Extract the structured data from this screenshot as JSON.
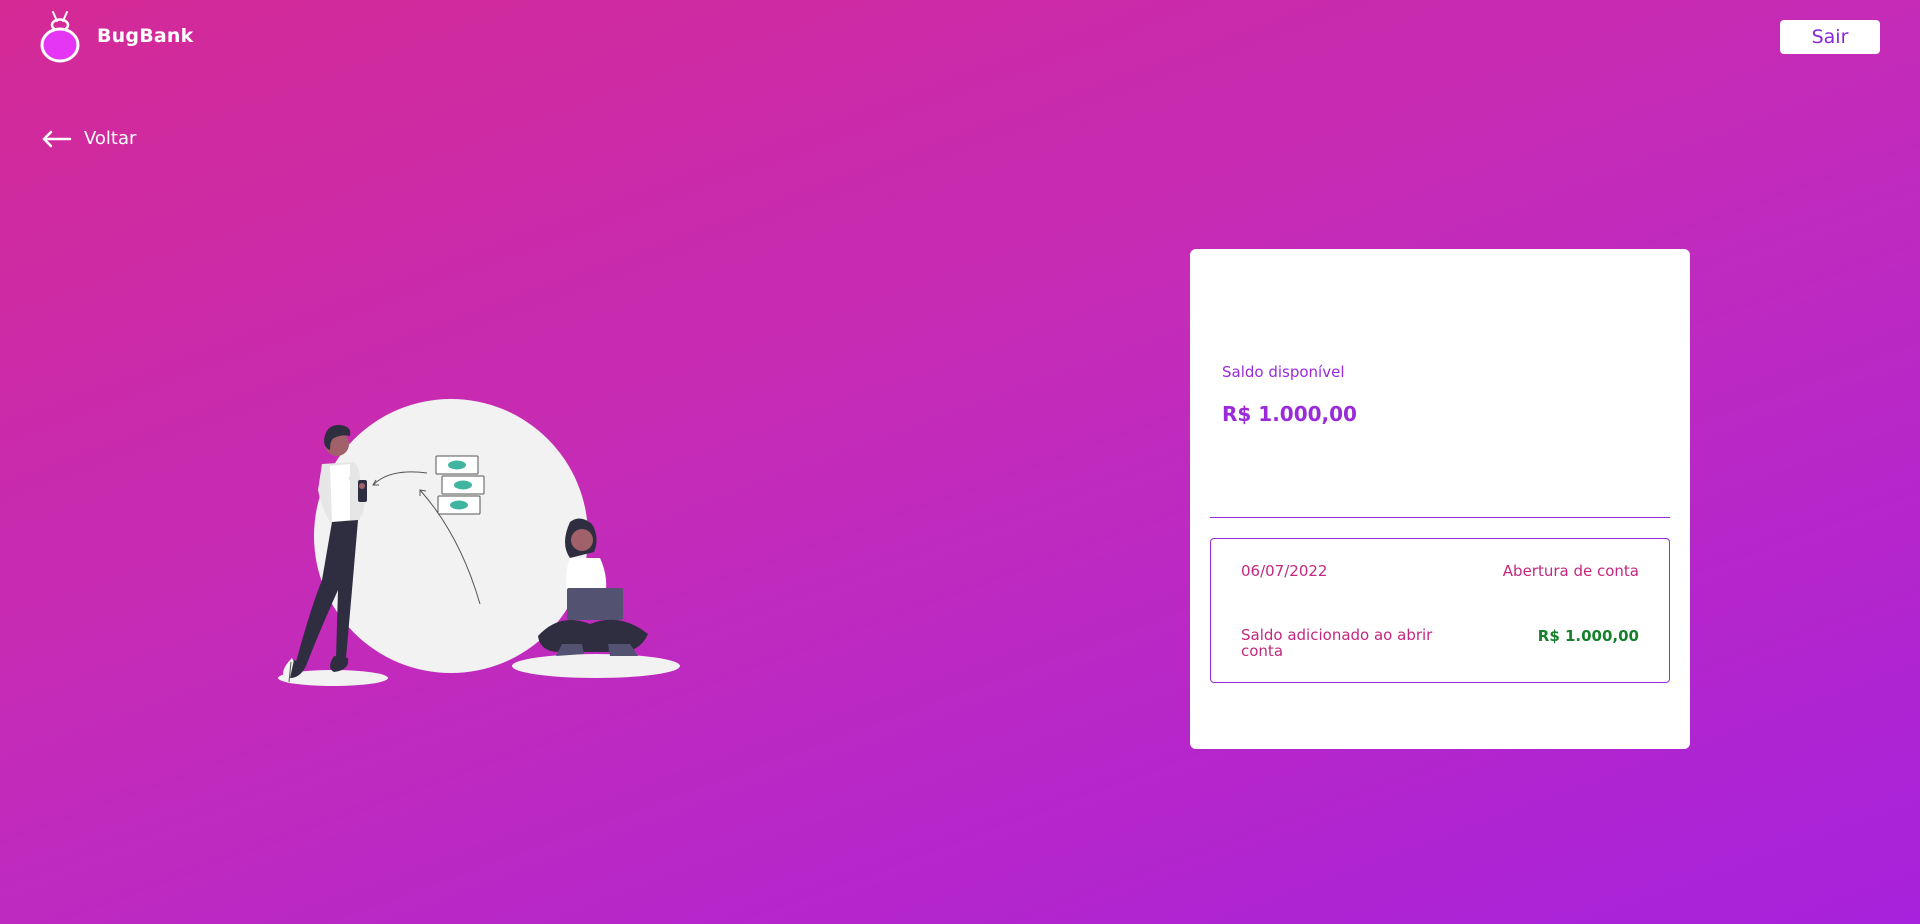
{
  "header": {
    "brand": "BugBank",
    "logout_label": "Sair"
  },
  "nav": {
    "back_label": "Voltar",
    "back_icon": "arrow-left-icon"
  },
  "illustration": {
    "icon": "money-transfer-illustration"
  },
  "balance": {
    "label": "Saldo disponível",
    "value": "R$ 1.000,00"
  },
  "transactions": [
    {
      "date": "06/07/2022",
      "type": "Abertura de conta",
      "description": "Saldo adicionado ao abrir conta",
      "amount": "R$ 1.000,00"
    }
  ],
  "colors": {
    "accent": "#9b2ad9",
    "transaction_text": "#c2287e",
    "positive_amount": "#16802c"
  }
}
